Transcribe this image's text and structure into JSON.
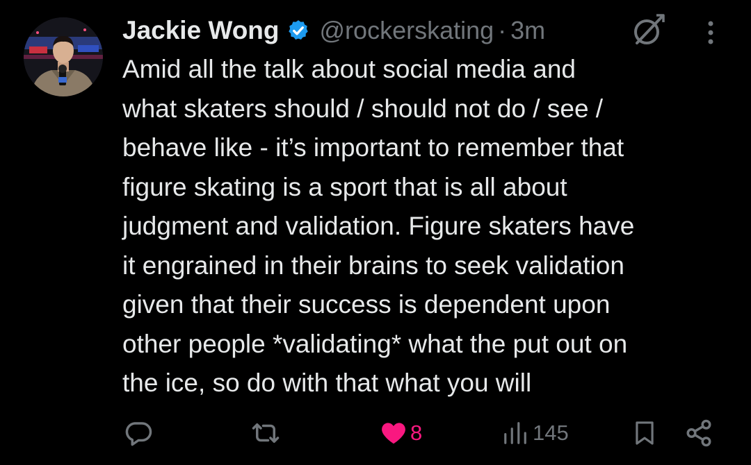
{
  "post": {
    "author_name": "Jackie Wong",
    "handle": "@rockerskating",
    "separator": "·",
    "time": "3m",
    "text": "Amid all the talk about social media and\nwhat skaters should / should not do / see /\nbehave like - it’s important to remember that\nfigure skating is a sport that is all about\njudgment and validation. Figure skaters have\nit engrained in their brains to seek validation\ngiven that their success is dependent upon\nother people *validating* what the put out on\nthe ice, so do with that what you will",
    "verified": true
  },
  "actions": {
    "like_count": "8",
    "view_count": "145"
  },
  "icons": {
    "verified": "verified-badge-icon",
    "grok": "grok-icon",
    "more": "more-vertical-icon",
    "reply": "reply-icon",
    "repost": "repost-icon",
    "like": "heart-icon",
    "views": "views-icon",
    "bookmark": "bookmark-icon",
    "share": "share-icon"
  },
  "colors": {
    "background": "#000000",
    "text": "#e7e9ea",
    "secondary": "#71767b",
    "verified": "#1d9bf0",
    "like": "#f91880"
  }
}
